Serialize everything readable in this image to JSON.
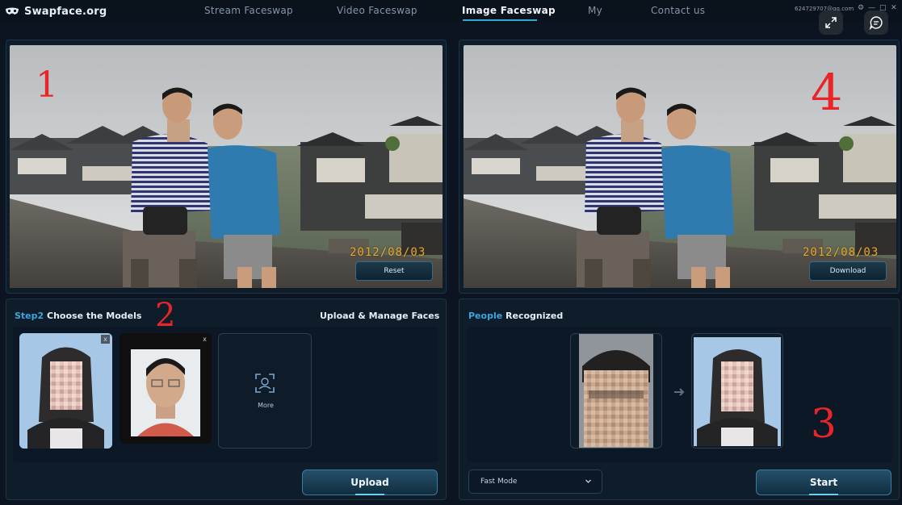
{
  "app": {
    "name": "Swapface.org"
  },
  "nav": {
    "items": [
      "Stream Faceswap",
      "Video Faceswap",
      "Image Faceswap",
      "My",
      "Contact us"
    ],
    "active": "Image Faceswap"
  },
  "account": {
    "email": "624729707@qq.com"
  },
  "window_controls": [
    "⚙",
    "—",
    "□",
    "✕"
  ],
  "source_panel": {
    "reset_label": "Reset",
    "date_stamp": "2012/08/03",
    "annotation": "1"
  },
  "result_panel": {
    "download_label": "Download",
    "date_stamp": "2012/08/03",
    "annotation": "4"
  },
  "models_panel": {
    "step_label": "Step2",
    "title": "Choose the Models",
    "upload_manage": "Upload & Manage Faces",
    "more_label": "More",
    "upload_label": "Upload",
    "close_glyph": "x",
    "annotation": "2"
  },
  "people_panel": {
    "title_accent": "People",
    "title_rest": "Recognized",
    "mode_value": "Fast Mode",
    "start_label": "Start",
    "annotation": "3"
  },
  "icons": [
    "mask-logo-icon",
    "expand-icon",
    "chat-icon",
    "face-scan-icon",
    "chevron-down-icon",
    "arrow-right-icon"
  ],
  "colors": {
    "accent": "#3aa6e0",
    "panel": "#0f1d2b",
    "background": "#0b1420",
    "annotation": "#e8262a"
  }
}
